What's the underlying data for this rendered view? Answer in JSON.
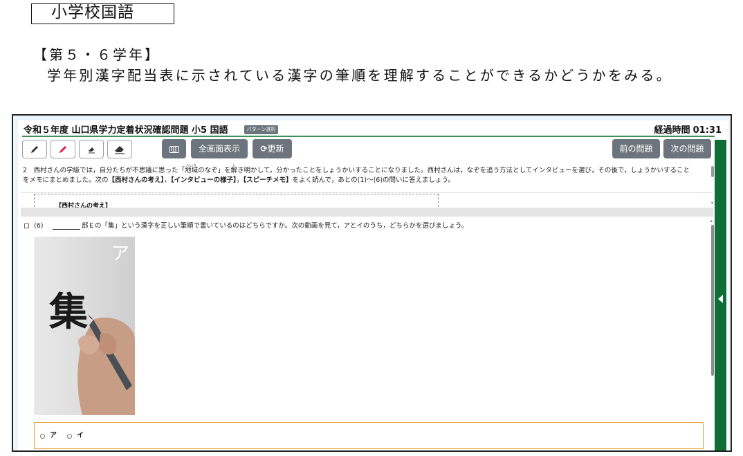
{
  "document": {
    "subject_title": "小学校国語",
    "grade": "【第５・６学年】",
    "description": "学年別漢字配当表に示されている漢字の筆順を理解することができるかどうかをみる。"
  },
  "app": {
    "title": "令和５年度 山口県学力定着状況確認問題 小5  国語",
    "pattern_badge": "パターン選択",
    "elapsed_label": "経過時間",
    "elapsed_time": "01:31",
    "toolbar": {
      "pencil_black": "pencil-black-icon",
      "pencil_red": "pencil-red-icon",
      "eraser_small": "eraser-small-icon",
      "eraser_large": "eraser-large-icon",
      "keyboard": "keyboard-icon",
      "fullscreen_label": "全画面表示",
      "refresh_label": "更新",
      "prev_label": "前の問題",
      "next_label": "次の問題"
    },
    "passage": {
      "number": "2",
      "text_a": "西村さんの学級では，自分たちが不思議に思った「",
      "ruby_base_1": "地域",
      "ruby_text_1": "ちいき",
      "text_b": "のなぞ」を",
      "ruby_base_2": "解",
      "ruby_text_2": "と",
      "text_c": "き明かして，分かったことをしょうかいすることになりました。西村さんは，なぞを追う方法としてインタビューを選び，その後で，しょうかいすること",
      "text_d": "をメモにまとめました。次の",
      "bold_1": "【西村さんの考え】",
      "sep_1": "，",
      "bold_2": "【インタビューの様子】",
      "sep_2": "，",
      "bold_3": "【スピーチメモ】",
      "text_e": "をよく読んで，あとの(1)～(6)の問いに答えましょう。",
      "box_label": "【西村さんの考え】"
    },
    "question": {
      "number": "(6)",
      "text": "部Ｅの「集」という漢字を正しい筆順で書いているのはどちらですか。次の動画を見て，アとイのうち，どちらかを選びましょう。",
      "video_label": "ア",
      "video_kanji": "集",
      "choices": [
        "ア",
        "イ"
      ]
    }
  }
}
